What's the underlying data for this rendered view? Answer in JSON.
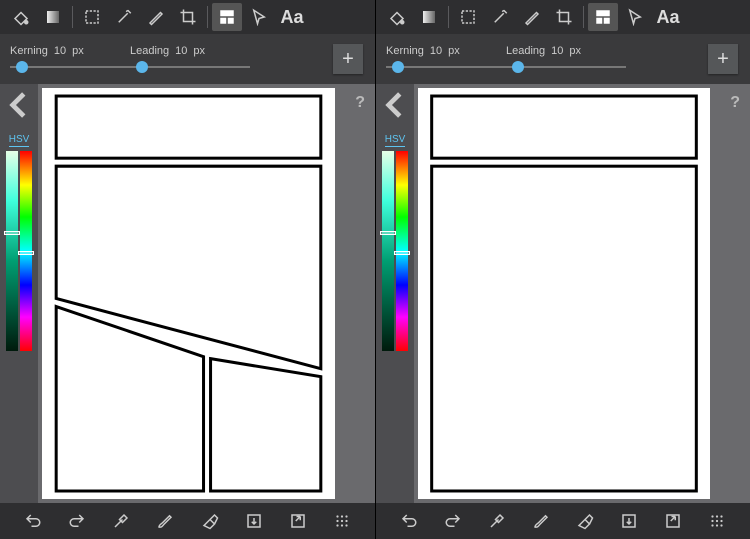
{
  "panels": [
    {
      "kerning": {
        "label": "Kerning",
        "value": 10,
        "unit": "px",
        "pos": 10
      },
      "leading": {
        "label": "Leading",
        "value": 10,
        "unit": "px",
        "pos": 10
      },
      "color": {
        "mode": "HSV",
        "lightness_handle_pct": 40,
        "hue_handle_pct": 50
      },
      "canvas": {
        "variant": "split"
      },
      "help": "?"
    },
    {
      "kerning": {
        "label": "Kerning",
        "value": 10,
        "unit": "px",
        "pos": 10
      },
      "leading": {
        "label": "Leading",
        "value": 10,
        "unit": "px",
        "pos": 10
      },
      "color": {
        "mode": "HSV",
        "lightness_handle_pct": 40,
        "hue_handle_pct": 50
      },
      "canvas": {
        "variant": "simple"
      },
      "help": "?"
    }
  ],
  "icons": {
    "top": [
      "bucket",
      "gradient",
      "marquee",
      "wand",
      "pen",
      "crop",
      "panel",
      "cursor",
      "text"
    ],
    "bottom": [
      "undo",
      "redo",
      "eyedropper",
      "brush",
      "eraser",
      "save",
      "export",
      "grid"
    ],
    "plus": "+",
    "text_label": "Aa"
  }
}
